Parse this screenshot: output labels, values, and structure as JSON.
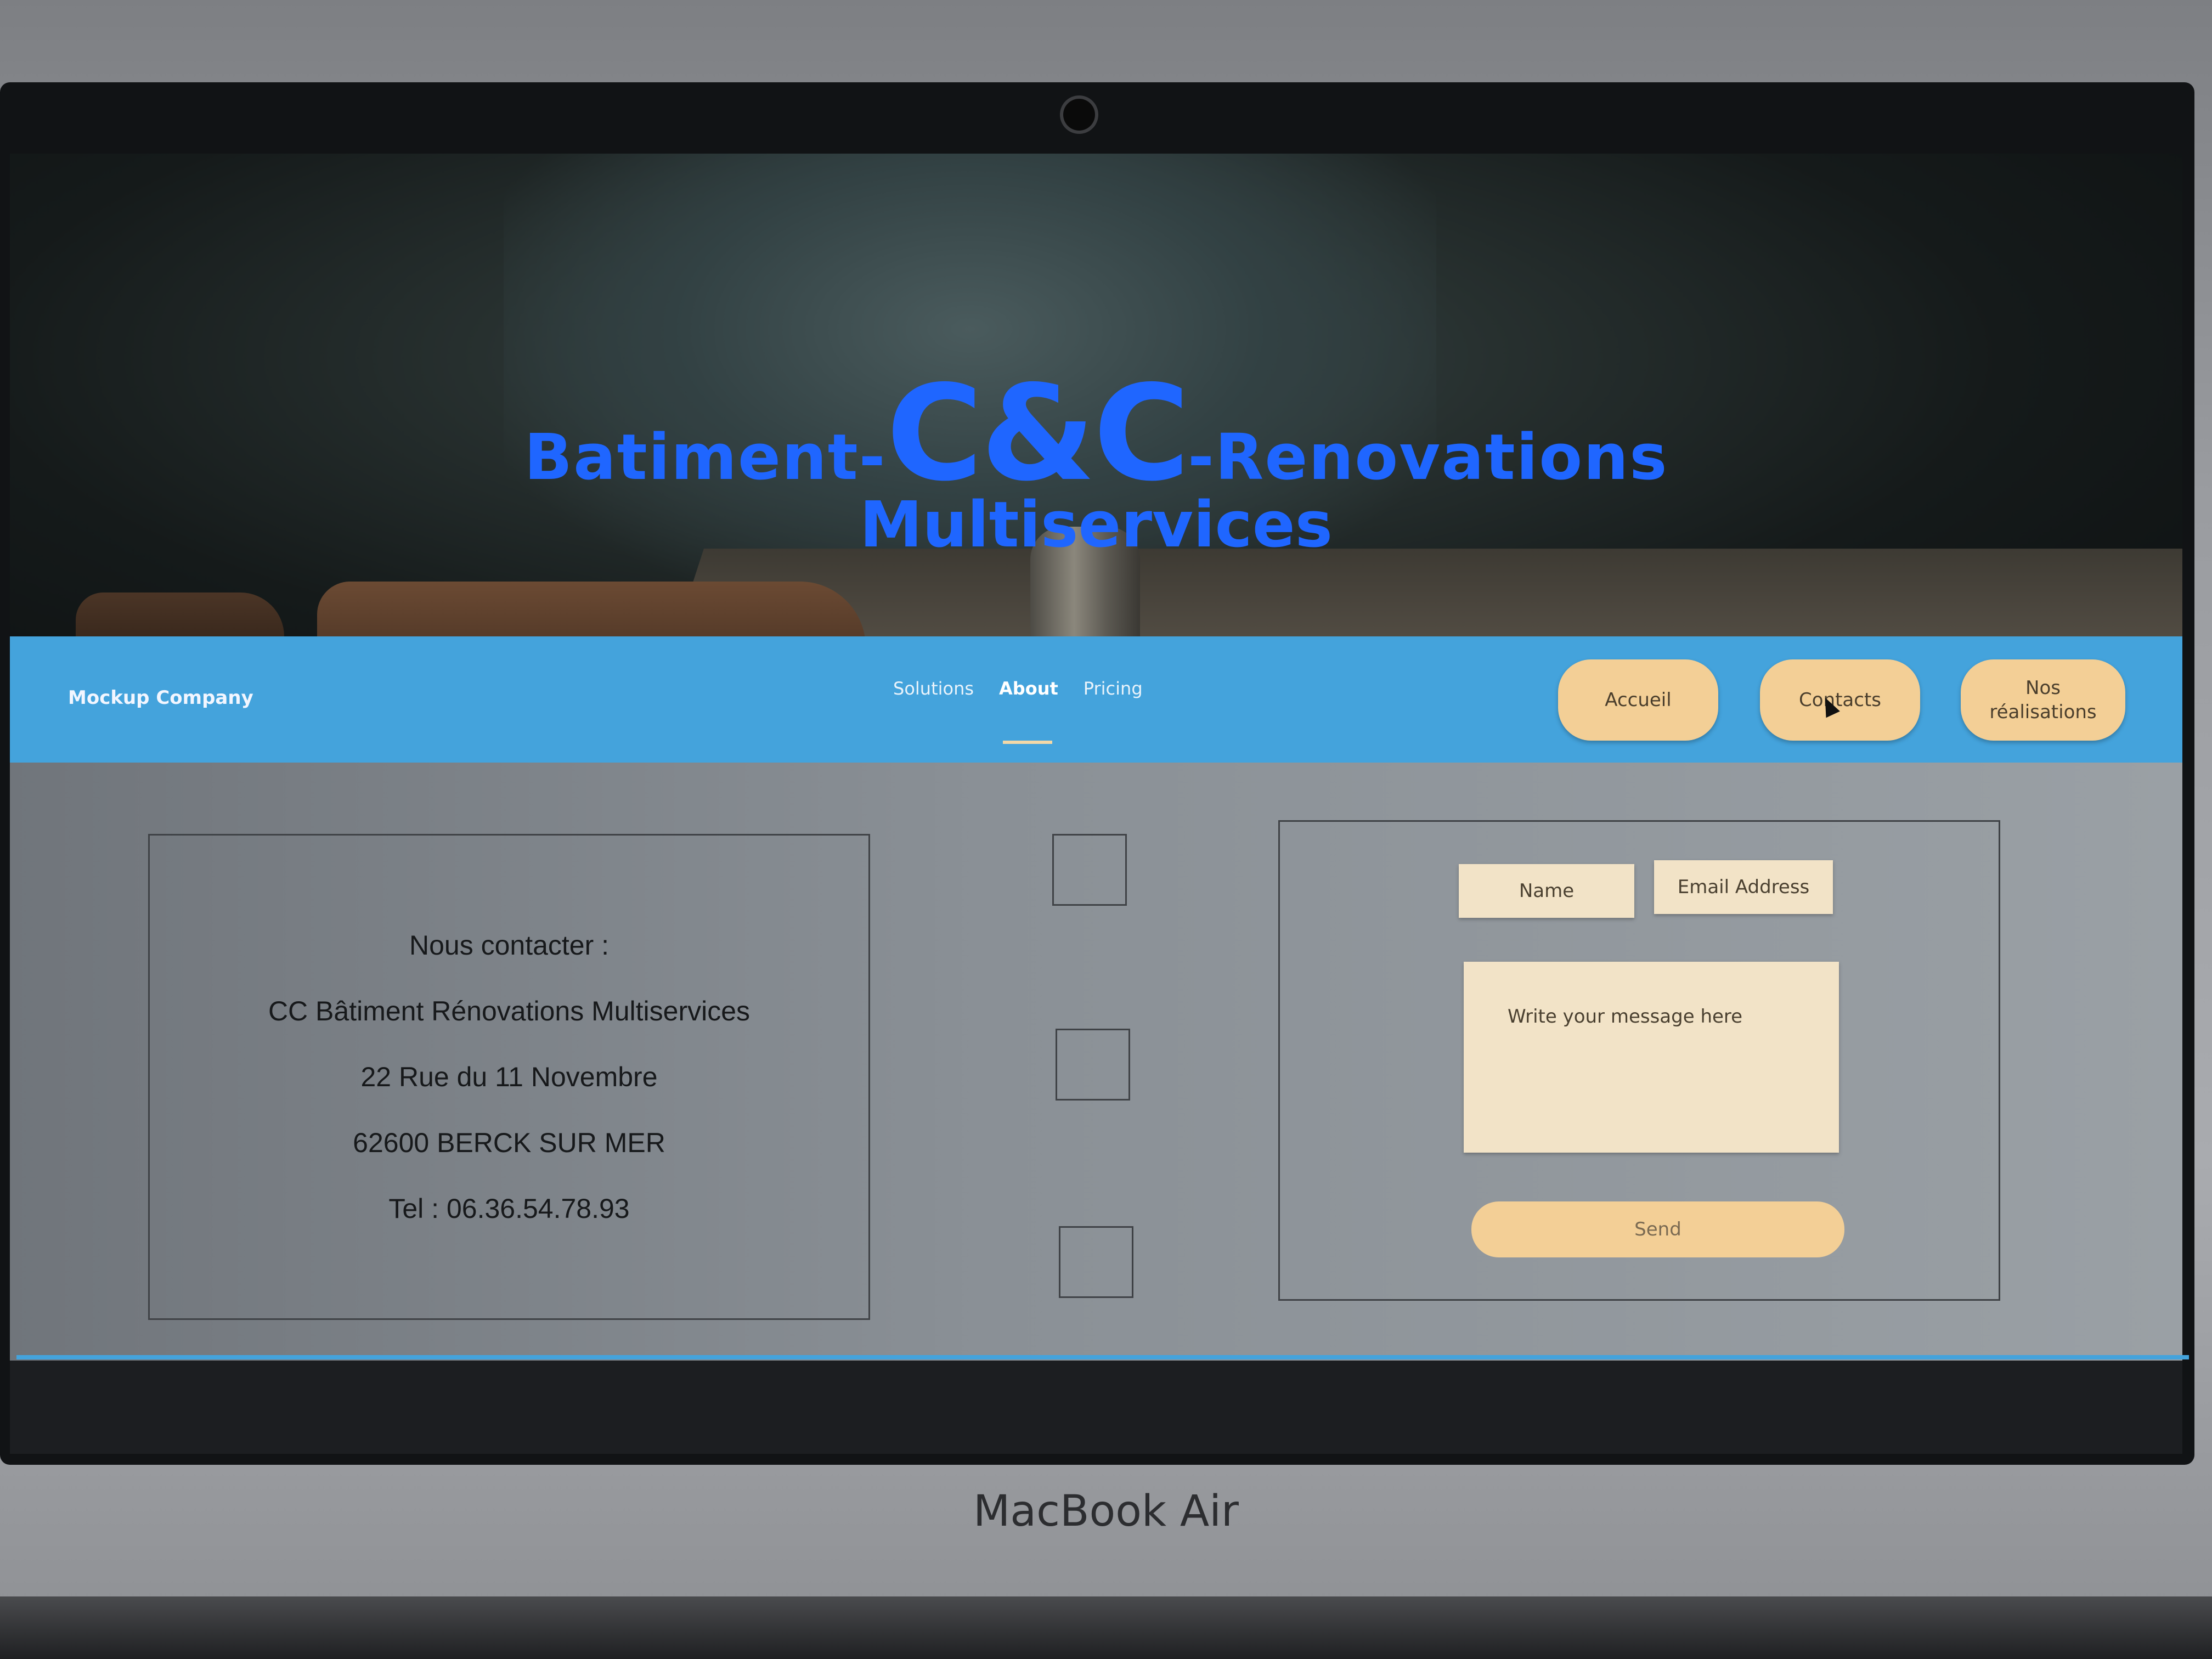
{
  "hero": {
    "title_left": "Batiment-",
    "title_mid": "C&C",
    "title_right": "-Renovations",
    "subtitle": "Multiservices"
  },
  "nav": {
    "brand": "Mockup Company",
    "links": [
      "Solutions",
      "About",
      "Pricing"
    ],
    "active": "About",
    "buttons": [
      "Accueil",
      "Contacts",
      "Nos réalisations"
    ]
  },
  "contact": {
    "lines": [
      "Nous contacter :",
      "CC Bâtiment Rénovations Multiservices",
      "22 Rue du 11 Novembre",
      "62600 BERCK SUR MER",
      "Tel : 06.36.54.78.93"
    ]
  },
  "form": {
    "name_placeholder": "Name",
    "email_placeholder": "Email Address",
    "message_placeholder": "Write your message here",
    "send_label": "Send"
  },
  "device": {
    "label": "MacBook Air"
  },
  "colors": {
    "accent": "#1f66ff",
    "navbar": "#44a3dc",
    "pill": "#f3cf96"
  }
}
